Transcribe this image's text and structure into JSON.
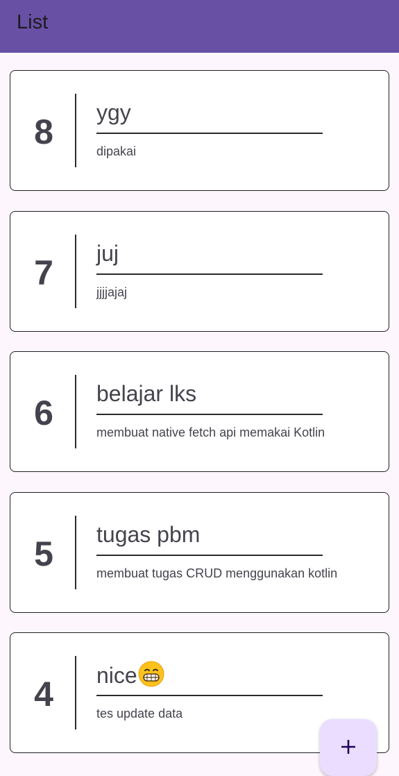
{
  "app_bar": {
    "title": "List"
  },
  "cards": [
    {
      "number": "8",
      "title": "ygy",
      "subtitle": "dipakai"
    },
    {
      "number": "7",
      "title": "juj",
      "subtitle": "jjjjajaj"
    },
    {
      "number": "6",
      "title": "belajar lks",
      "subtitle": "membuat native fetch api memakai Kotlin"
    },
    {
      "number": "5",
      "title": "tugas pbm",
      "subtitle": "membuat tugas CRUD menggunakan kotlin"
    },
    {
      "number": "4",
      "title": "nice",
      "title_emoji": "grinning-face-emoji",
      "subtitle": "tes update data"
    }
  ],
  "fab": {
    "icon": "plus-icon"
  },
  "colors": {
    "app_bar": "#6850a4",
    "background": "#fdf6fc",
    "card_text": "#44434d",
    "fab": "#eaddff"
  }
}
